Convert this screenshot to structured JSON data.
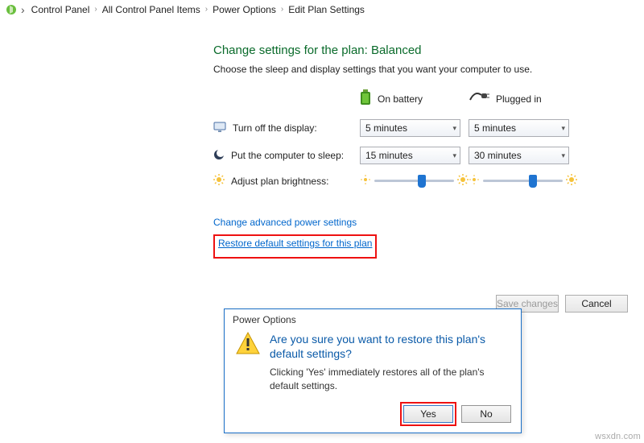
{
  "breadcrumb": {
    "items": [
      "Control Panel",
      "All Control Panel Items",
      "Power Options",
      "Edit Plan Settings"
    ]
  },
  "page": {
    "title": "Change settings for the plan: Balanced",
    "subtitle": "Choose the sleep and display settings that you want your computer to use."
  },
  "columns": {
    "battery": "On battery",
    "plugged": "Plugged in"
  },
  "settings": {
    "display_off": {
      "label": "Turn off the display:",
      "battery": "5 minutes",
      "plugged": "5 minutes"
    },
    "sleep": {
      "label": "Put the computer to sleep:",
      "battery": "15 minutes",
      "plugged": "30 minutes"
    },
    "brightness": {
      "label": "Adjust plan brightness:",
      "battery_pct": 55,
      "plugged_pct": 58
    }
  },
  "links": {
    "advanced": "Change advanced power settings",
    "restore": "Restore default settings for this plan"
  },
  "buttons": {
    "save": "Save changes",
    "cancel": "Cancel"
  },
  "dialog": {
    "title": "Power Options",
    "question": "Are you sure you want to restore this plan's default settings?",
    "explain": "Clicking 'Yes' immediately restores all of the plan's default settings.",
    "yes": "Yes",
    "no": "No"
  },
  "watermark": "wsxdn.com"
}
